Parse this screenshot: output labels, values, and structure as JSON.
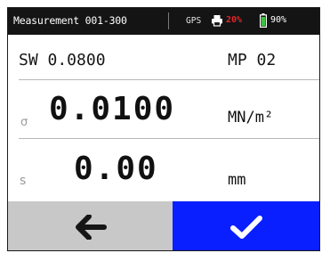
{
  "status": {
    "title": "Measurement 001-300",
    "gps": "GPS",
    "printer_pct": "20%",
    "battery_pct": "90%",
    "printer_icon": "printer-icon",
    "battery_icon": "battery-icon",
    "colors": {
      "bar": "#141414",
      "printer_pct": "#e0262a",
      "battery": "#3fbf3f"
    }
  },
  "measurement": {
    "sw": "SW 0.0800",
    "mp": "MP 02",
    "sigma_label": "σ",
    "sigma_value": "0.0100",
    "sigma_unit": "MN/m²",
    "s_label": "s",
    "s_value": "0.00",
    "s_unit": "mm"
  },
  "buttons": {
    "back_icon": "arrow-left-icon",
    "confirm_icon": "checkmark-icon",
    "colors": {
      "back": "#c8c8c8",
      "confirm": "#0a1fff"
    }
  }
}
